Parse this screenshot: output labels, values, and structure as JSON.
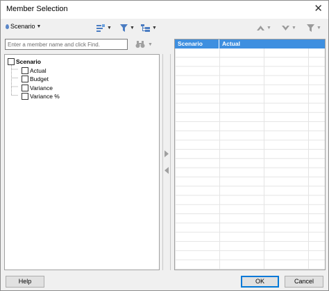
{
  "window": {
    "title": "Member Selection",
    "close_glyph": "✕"
  },
  "toolbar": {
    "dimension_label": "Scenario",
    "icons": [
      "layout-icon",
      "filter-icon",
      "tree-view-icon",
      "move-up-icon",
      "move-down-icon",
      "filter-right-icon"
    ]
  },
  "search": {
    "placeholder": "Enter a member name and click Find.",
    "value": ""
  },
  "tree": {
    "root": "Scenario",
    "children": [
      "Actual",
      "Budget",
      "Variance",
      "Variance %"
    ]
  },
  "selection_grid": {
    "columns": [
      "Scenario",
      "Actual"
    ],
    "header_color": "#3e8fe0"
  },
  "buttons": {
    "help": "Help",
    "ok": "OK",
    "cancel": "Cancel"
  }
}
